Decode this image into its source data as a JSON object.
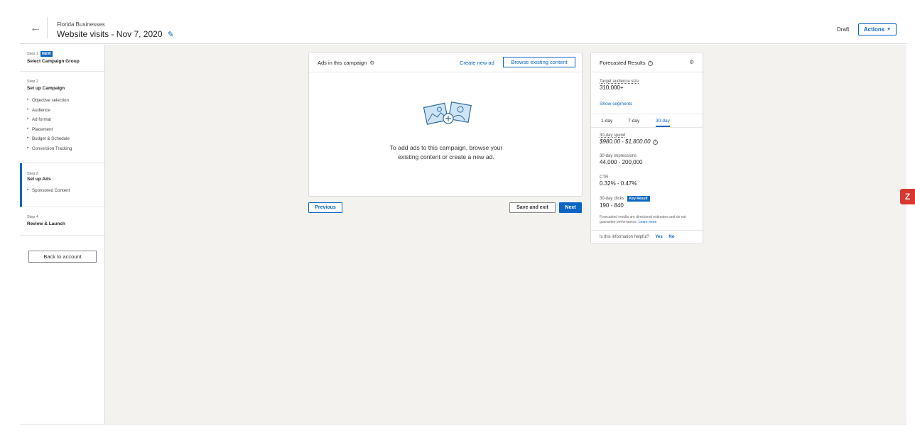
{
  "header": {
    "account_name": "Florida Businesses",
    "campaign_title": "Website visits - Nov 7, 2020",
    "status": "Draft",
    "actions_label": "Actions"
  },
  "sidebar": {
    "steps": [
      {
        "step": "Step 1",
        "badge": "NEW",
        "title": "Select Campaign Group",
        "items": []
      },
      {
        "step": "Step 2",
        "title": "Set up Campaign",
        "items": [
          "Objective selection",
          "Audience",
          "Ad format",
          "Placement",
          "Budget & Schedule",
          "Conversion Tracking"
        ]
      },
      {
        "step": "Step 3",
        "title": "Set up Ads",
        "items": [
          "Sponsored Content"
        ]
      },
      {
        "step": "Step 4",
        "title": "Review & Launch",
        "items": []
      }
    ],
    "back_label": "Back to account"
  },
  "ads_card": {
    "title": "Ads in this campaign",
    "create_link": "Create new ad",
    "browse_label": "Browse existing content",
    "empty_message": "To add ads to this campaign, browse your existing content or create a new ad."
  },
  "footer_buttons": {
    "previous": "Previous",
    "save_exit": "Save and exit",
    "next": "Next"
  },
  "forecast": {
    "title": "Forecasted Results",
    "audience_label": "Target audience size",
    "audience_value": "310,000+",
    "show_segments": "Show segments",
    "tabs": [
      "1-day",
      "7-day",
      "30-day"
    ],
    "active_tab": "30-day",
    "spend_label": "30-day spend",
    "spend_value": "$980.00 - $1,800.00",
    "impressions_label": "30-day impressions",
    "impressions_value": "44,000 - 200,000",
    "ctr_label": "CTR",
    "ctr_value": "0.32% - 0.47%",
    "clicks_label": "30-day clicks",
    "clicks_badge": "Key Result",
    "clicks_value": "190 - 840",
    "disclaimer": "Forecasted results are directional estimates and do not guarantee performance.",
    "learn_more": "Learn more",
    "helpful_q": "Is this information helpful?",
    "yes": "Yes",
    "no": "No"
  },
  "widget": {
    "glyph": "Z"
  },
  "colors": {
    "accent": "#0a66c2",
    "background": "#f3f2ef",
    "widget": "#d9372f"
  },
  "icons": [
    "back-arrow-icon",
    "pencil-icon",
    "caret-down-icon",
    "gear-icon",
    "help-icon",
    "add-media-illustration"
  ]
}
